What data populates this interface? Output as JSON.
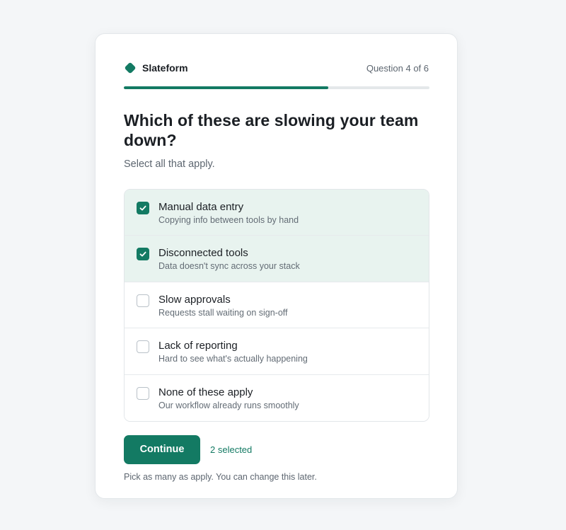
{
  "brand": {
    "name": "Slateform",
    "accent": "#137a63"
  },
  "progress": {
    "label": "Question 4 of 6",
    "fraction": 0.67
  },
  "question": {
    "title": "Which of these are slowing your team down?",
    "hint": "Select all that apply."
  },
  "options": [
    {
      "title": "Manual data entry",
      "description": "Copying info between tools by hand",
      "checked": true
    },
    {
      "title": "Disconnected tools",
      "description": "Data doesn't sync across your stack",
      "checked": true
    },
    {
      "title": "Slow approvals",
      "description": "Requests stall waiting on sign-off",
      "checked": false
    },
    {
      "title": "Lack of reporting",
      "description": "Hard to see what's actually happening",
      "checked": false
    },
    {
      "title": "None of these apply",
      "description": "Our workflow already runs smoothly",
      "checked": false
    }
  ],
  "actions": {
    "continue_label": "Continue",
    "selected_count": "2 selected"
  },
  "footnote": "Pick as many as apply. You can change this later."
}
